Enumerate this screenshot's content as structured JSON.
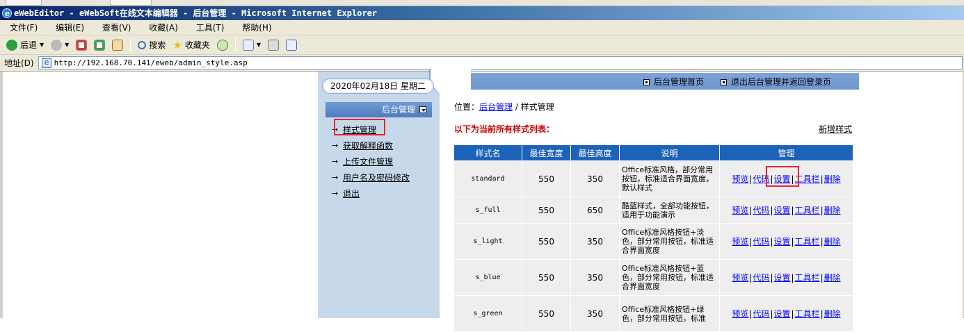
{
  "window": {
    "title": "eWebEditor - eWebSoft在线文本编辑器 - 后台管理 - Microsoft Internet Explorer"
  },
  "menu": [
    "文件(F)",
    "编辑(E)",
    "查看(V)",
    "收藏(A)",
    "工具(T)",
    "帮助(H)"
  ],
  "toolbar": {
    "back": "后退",
    "search": "搜索",
    "favorites": "收藏夹"
  },
  "address": {
    "label": "地址(D)",
    "url": "http://192.168.70.141/eweb/admin_style.asp"
  },
  "header": {
    "date": "2020年02月18日 星期二",
    "links": [
      "后台管理首页",
      "退出后台管理并返回登录页"
    ]
  },
  "sidebar": {
    "title": "后台管理",
    "items": [
      {
        "label": "样式管理"
      },
      {
        "label": "获取解释函数"
      },
      {
        "label": "上传文件管理"
      },
      {
        "label": "用户名及密码修改"
      },
      {
        "label": "退出"
      }
    ]
  },
  "main": {
    "crumb_prefix": "位置：",
    "crumb_link": "后台管理",
    "crumb_sep": " / ",
    "crumb_current": "样式管理",
    "list_title": "以下为当前所有样式列表：",
    "new_style": "新增样式",
    "columns": [
      "样式名",
      "最佳宽度",
      "最佳高度",
      "说明",
      "管理"
    ],
    "ops": [
      "预览",
      "代码",
      "设置",
      "工具栏",
      "删除"
    ],
    "rows": [
      {
        "name": "standard",
        "width": "550",
        "height": "350",
        "desc": "Office标准风格，部分常用按钮，标准适合界面宽度，默认样式"
      },
      {
        "name": "s_full",
        "width": "550",
        "height": "650",
        "desc": "酷蓝样式，全部功能按钮，适用于功能演示"
      },
      {
        "name": "s_light",
        "width": "550",
        "height": "350",
        "desc": "Office标准风格按钮+淡色，部分常用按钮，标准适合界面宽度"
      },
      {
        "name": "s_blue",
        "width": "550",
        "height": "350",
        "desc": "Office标准风格按钮+蓝色，部分常用按钮，标准适合界面宽度"
      },
      {
        "name": "s_green",
        "width": "550",
        "height": "350",
        "desc": "Office标准风格按钮+绿色，部分常用按钮，标准"
      }
    ]
  },
  "colors": {
    "header_blue": "#1c62b8",
    "sidebar_bg": "#c7d8ea",
    "title_red": "#cc0000",
    "highlight": "#e8232e"
  }
}
